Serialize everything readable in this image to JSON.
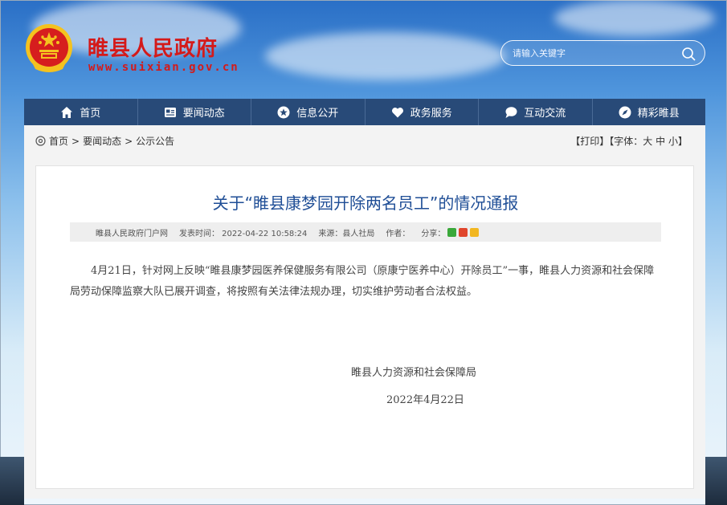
{
  "header": {
    "site_title": "睢县人民政府",
    "site_url": "www.suixian.gov.cn",
    "search_placeholder": "请输入关键字"
  },
  "nav": {
    "items": [
      {
        "label": "首页",
        "icon": "home-icon"
      },
      {
        "label": "要闻动态",
        "icon": "newspaper-icon"
      },
      {
        "label": "信息公开",
        "icon": "star-icon"
      },
      {
        "label": "政务服务",
        "icon": "heart-hands-icon"
      },
      {
        "label": "互动交流",
        "icon": "chat-bubble-icon"
      },
      {
        "label": "精彩睢县",
        "icon": "compass-icon"
      }
    ]
  },
  "breadcrumb": {
    "items": [
      "首页",
      "要闻动态",
      "公示公告"
    ],
    "separator": ">"
  },
  "tools": {
    "print": "【打印】",
    "font_label": "【字体：",
    "large": "大",
    "medium": "中",
    "small": "小",
    "close": "】"
  },
  "article": {
    "title": "关于“睢县康梦园开除两名员工”的情况通报",
    "meta_source_site": "睢县人民政府门户网",
    "meta_publish": "发表时间： 2022-04-22 10:58:24",
    "meta_origin": "来源：县人社局",
    "meta_author": "作者：",
    "meta_share": "分享：",
    "body": "4月21日，针对网上反映“睢县康梦园医养保健服务有限公司（原康宁医养中心）开除员工”一事，睢县人力资源和社会保障局劳动保障监察大队已展开调查，将按照有关法律法规办理，切实维护劳动者合法权益。",
    "signature": "睢县人力资源和社会保障局",
    "date": "2022年4月22日"
  },
  "colors": {
    "nav_bg": "#284a78",
    "title_red": "#d41a1a",
    "article_title": "#1f4e96"
  }
}
